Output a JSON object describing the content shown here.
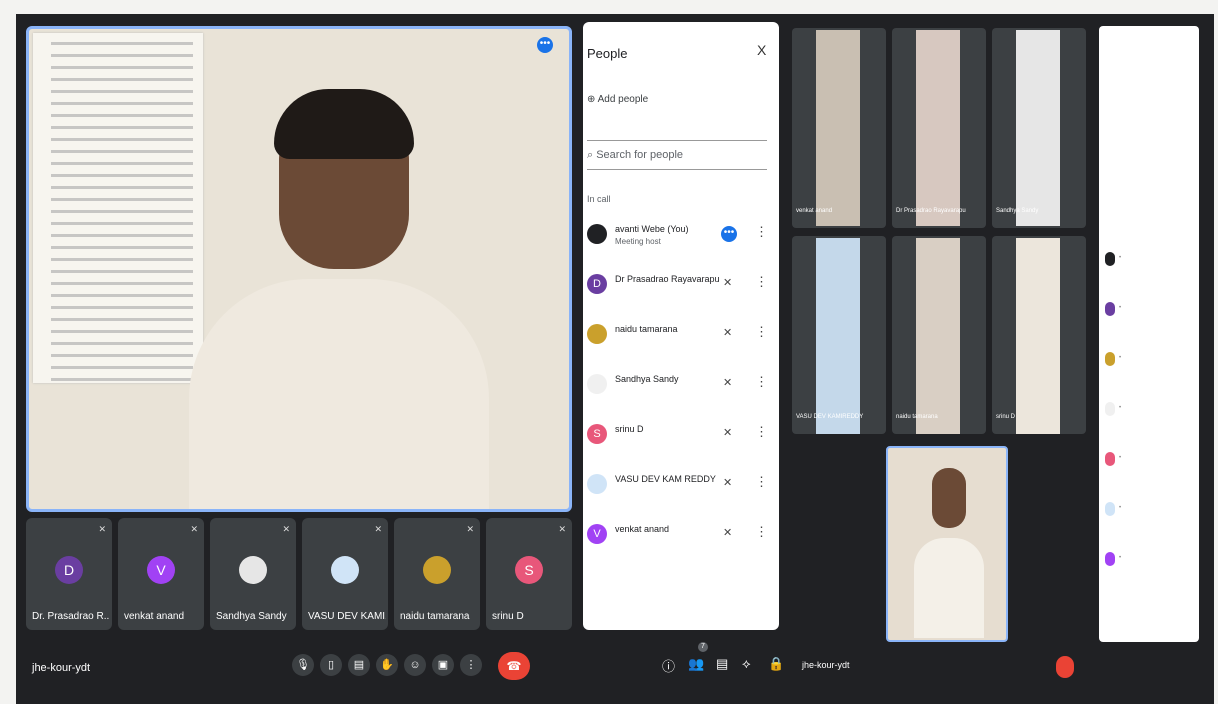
{
  "main": {
    "meeting_code": "jhe-kour-ydt",
    "participants_count": "7",
    "tiles": [
      {
        "name": "Dr. Prasadrao R...",
        "initial": "D",
        "color": "#6a3ea1"
      },
      {
        "name": "venkat anand",
        "initial": "V",
        "color": "#a142f4"
      },
      {
        "name": "Sandhya Sandy",
        "initial": "",
        "color": "#e6e6e6"
      },
      {
        "name": "VASU DEV KAMI...",
        "initial": "",
        "color": "#d0e4f7"
      },
      {
        "name": "naidu tamarana",
        "initial": "",
        "color": "#caa02c"
      },
      {
        "name": "srinu D",
        "initial": "S",
        "color": "#e8577a"
      }
    ],
    "toolbar_icons": [
      "mic-icon",
      "captions-icon",
      "present-icon",
      "hand-icon",
      "emoji-icon",
      "screen-icon",
      "more-icon"
    ],
    "right_icons": [
      "info-icon",
      "people-icon",
      "chat-icon",
      "activities-icon",
      "lock-icon"
    ]
  },
  "people_panel": {
    "title": "People",
    "close": "X",
    "add_people": "Add people",
    "search_placeholder": "Search for people",
    "section": "In call",
    "rows": [
      {
        "name": "avanti Webe (You)",
        "sub": "Meeting host",
        "initial": "",
        "color": "#202124"
      },
      {
        "name": "Dr Prasadrao Rayavarapu",
        "sub": "",
        "initial": "D",
        "color": "#6a3ea1"
      },
      {
        "name": "naidu tamarana",
        "sub": "",
        "initial": "",
        "color": "#caa02c"
      },
      {
        "name": "Sandhya Sandy",
        "sub": "",
        "initial": "",
        "color": "#f0f0f0"
      },
      {
        "name": "srinu D",
        "sub": "",
        "initial": "S",
        "color": "#e8577a"
      },
      {
        "name": "VASU DEV KAM REDDY",
        "sub": "",
        "initial": "",
        "color": "#d0e4f7"
      },
      {
        "name": "venkat anand",
        "sub": "",
        "initial": "V",
        "color": "#a142f4"
      }
    ]
  },
  "right_meeting": {
    "meeting_code": "jhe-kour-ydt",
    "tiles": [
      {
        "name": "venkat anand"
      },
      {
        "name": "Dr Prasadrao Rayavarapu"
      },
      {
        "name": "Sandhya Sandy"
      },
      {
        "name": "VASU DEV KAMIREDDY"
      },
      {
        "name": "naidu tamarana"
      },
      {
        "name": "srinu D"
      }
    ]
  },
  "colors": {
    "accent": "#1a73e8",
    "end_call": "#ea4335",
    "tile_bg": "#3c4043",
    "frame_bg": "#202124"
  }
}
